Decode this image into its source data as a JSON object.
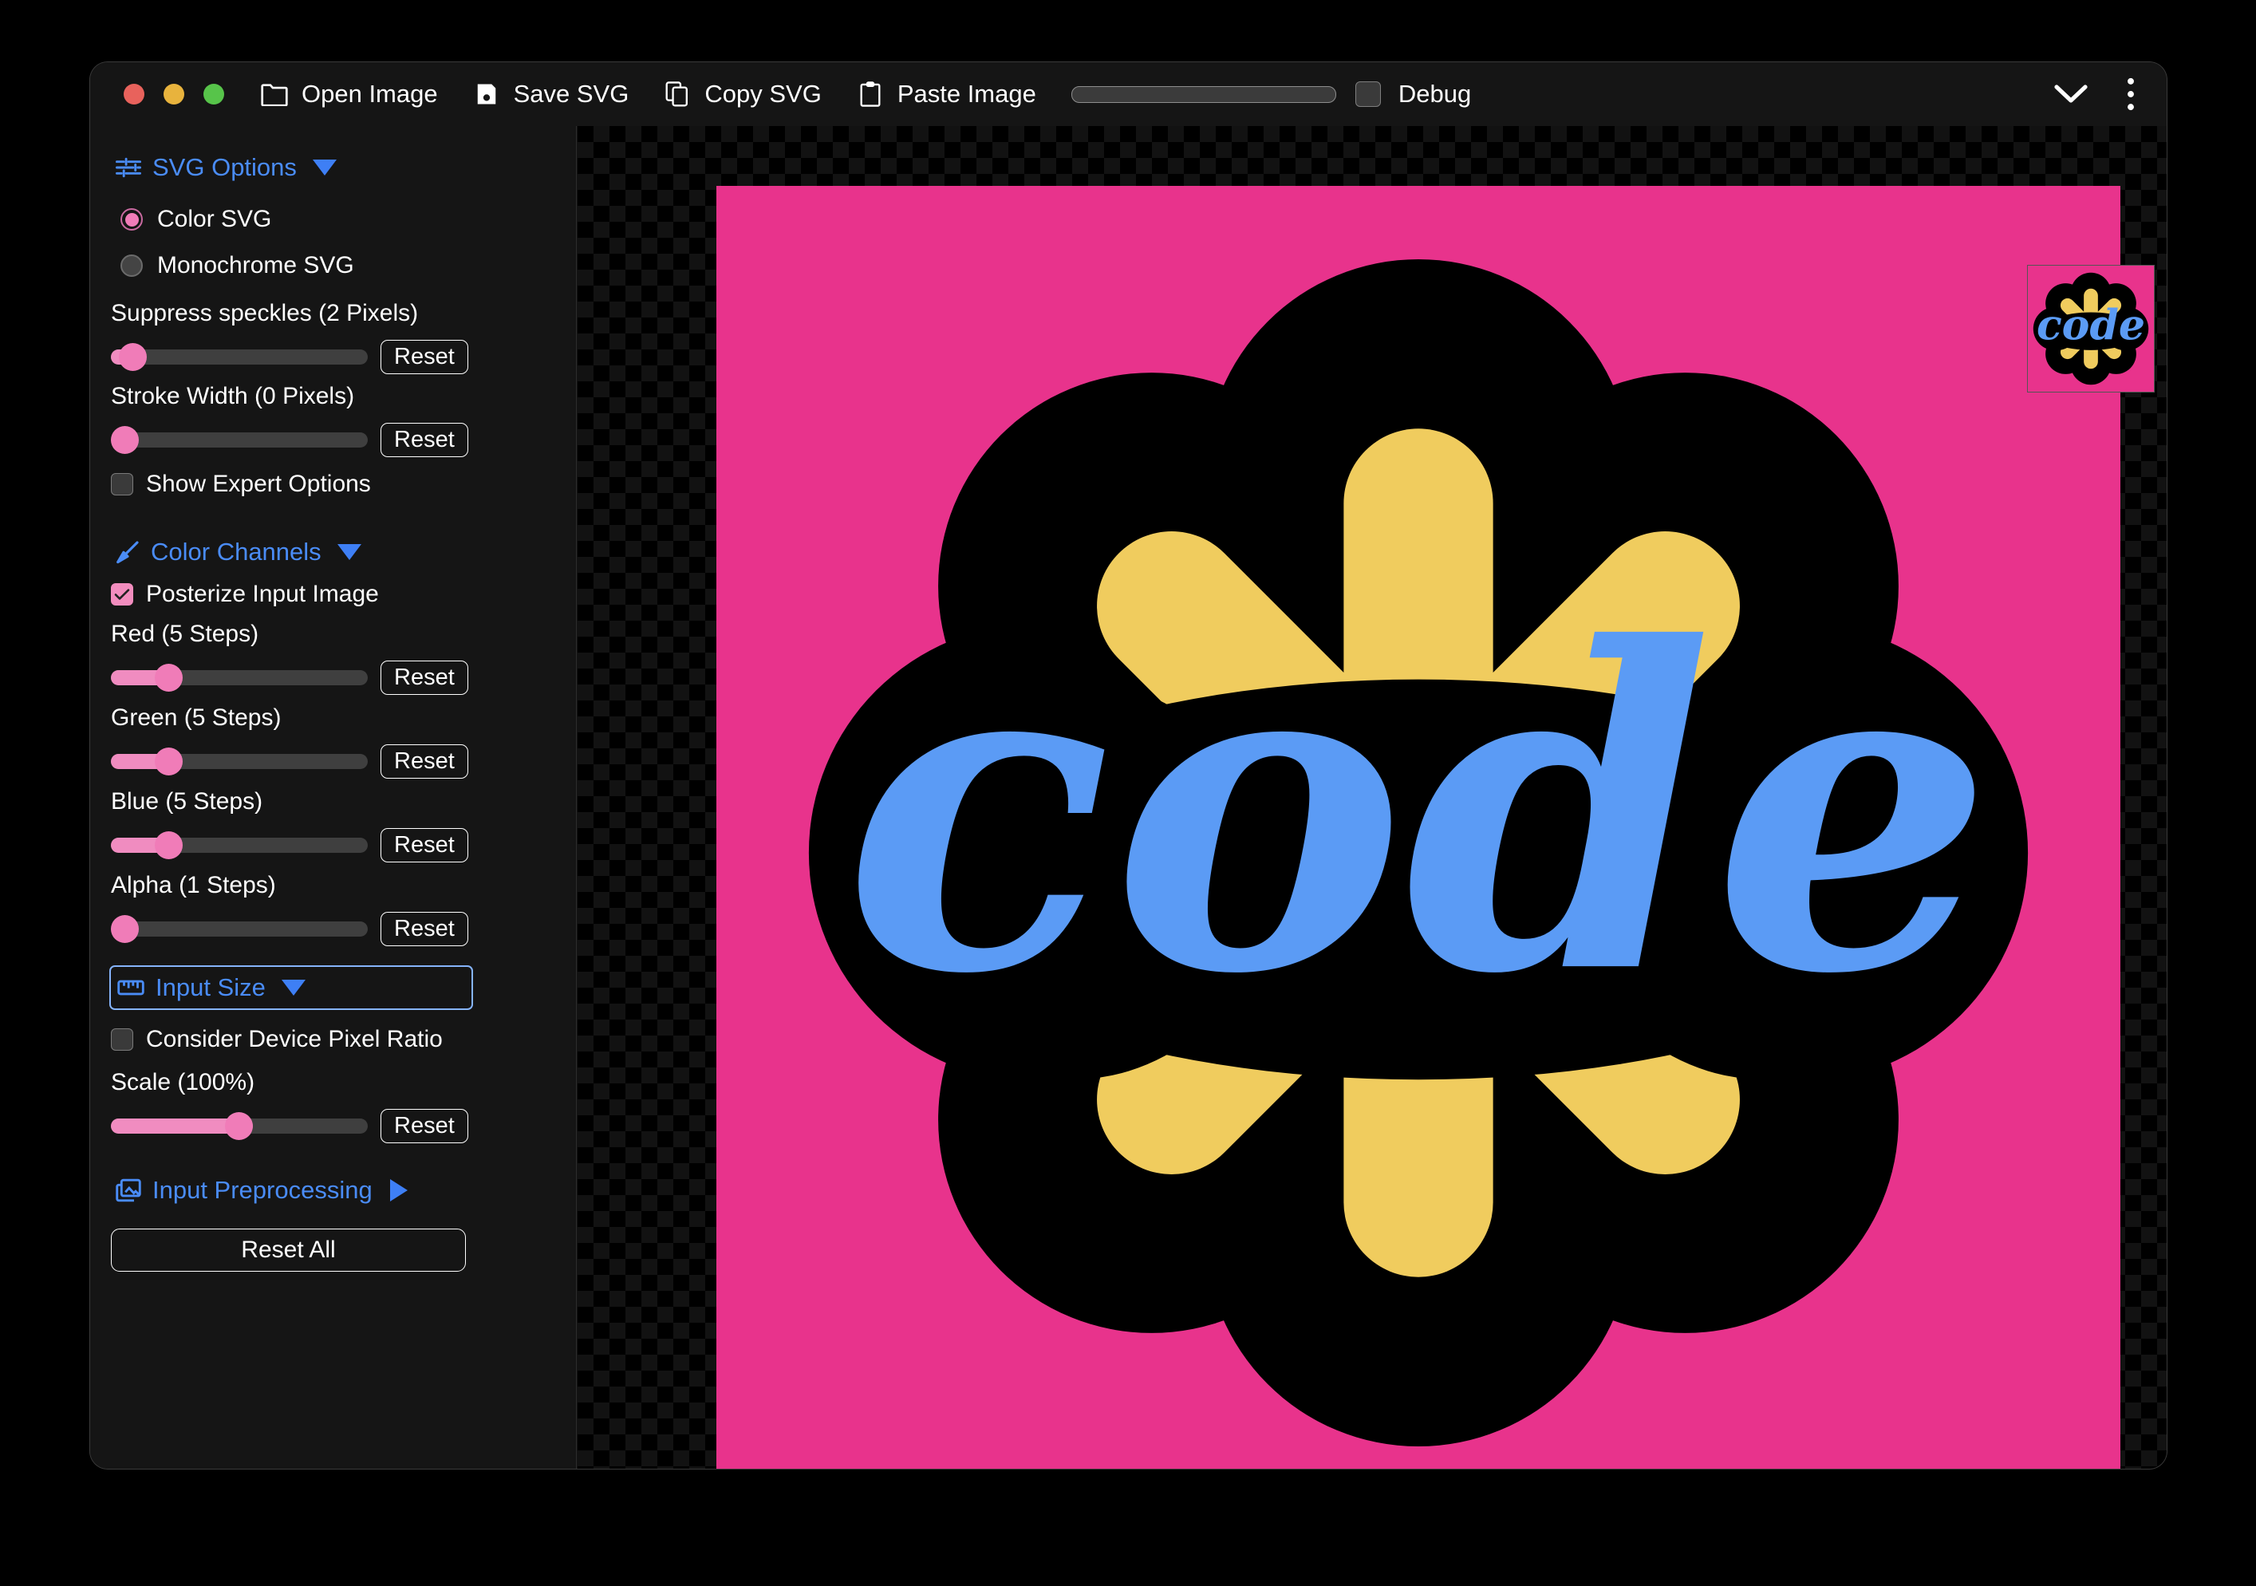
{
  "window": {
    "traffic_lights": [
      "close",
      "minimize",
      "maximize"
    ],
    "colors": {
      "close": "#e8625c",
      "minimize": "#e8b33d",
      "maximize": "#57c44a"
    }
  },
  "toolbar": {
    "buttons": [
      {
        "label": "Open Image",
        "icon": "folder-icon"
      },
      {
        "label": "Save SVG",
        "icon": "save-disk-icon"
      },
      {
        "label": "Copy SVG",
        "icon": "copy-icon"
      },
      {
        "label": "Paste Image",
        "icon": "clipboard-icon"
      }
    ],
    "progress": {
      "name": "progress-bar",
      "value": 0
    },
    "debug": {
      "label": "Debug",
      "checked": false
    },
    "right_icons": [
      {
        "name": "chevron-down-icon"
      },
      {
        "name": "more-vertical-icon"
      }
    ]
  },
  "sidebar": {
    "sections": [
      {
        "id": "svg-options",
        "title": "SVG Options",
        "icon": "sliders-icon",
        "expanded": true,
        "caret": "down",
        "focused": false
      },
      {
        "id": "color-channels",
        "title": "Color Channels",
        "icon": "brush-icon",
        "expanded": true,
        "caret": "down",
        "focused": false
      },
      {
        "id": "input-size",
        "title": "Input Size",
        "icon": "ruler-icon",
        "expanded": true,
        "caret": "down",
        "focused": true
      },
      {
        "id": "input-preprocessing",
        "title": "Input Preprocessing",
        "icon": "images-icon",
        "expanded": false,
        "caret": "right",
        "focused": false
      }
    ],
    "radios": [
      {
        "label": "Color SVG",
        "selected": true
      },
      {
        "label": "Monochrome SVG",
        "selected": false
      }
    ],
    "checkboxes": [
      {
        "id": "show-expert-options",
        "label": "Show Expert Options",
        "checked": false
      },
      {
        "id": "posterize-input-image",
        "label": "Posterize Input Image",
        "checked": true
      },
      {
        "id": "consider-device-pixel-ratio",
        "label": "Consider Device Pixel Ratio",
        "checked": false
      }
    ],
    "sliders": [
      {
        "id": "suppress-speckles",
        "label": "Suppress speckles (2 Pixels)",
        "value": 2,
        "unit": "Pixels",
        "percent": 6,
        "reset_label": "Reset"
      },
      {
        "id": "stroke-width",
        "label": "Stroke Width (0 Pixels)",
        "value": 0,
        "unit": "Pixels",
        "percent": 0,
        "reset_label": "Reset"
      },
      {
        "id": "red",
        "label": "Red (5 Steps)",
        "value": 5,
        "unit": "Steps",
        "percent": 17,
        "reset_label": "Reset"
      },
      {
        "id": "green",
        "label": "Green (5 Steps)",
        "value": 5,
        "unit": "Steps",
        "percent": 17,
        "reset_label": "Reset"
      },
      {
        "id": "blue",
        "label": "Blue (5 Steps)",
        "value": 5,
        "unit": "Steps",
        "percent": 17,
        "reset_label": "Reset"
      },
      {
        "id": "alpha",
        "label": "Alpha (1 Steps)",
        "value": 1,
        "unit": "Steps",
        "percent": 0,
        "reset_label": "Reset"
      },
      {
        "id": "scale",
        "label": "Scale (100%)",
        "value": 100,
        "unit": "%",
        "percent": 50,
        "reset_label": "Reset"
      }
    ],
    "reset_all_label": "Reset All",
    "accent_color": "#f07cb8",
    "link_color": "#4a8cf7",
    "focus_color": "#86b4fb"
  },
  "canvas": {
    "artwork": {
      "name": "code-flower-logo",
      "background": "#e8338c",
      "outline": "#000000",
      "petal_color": "#f0cc5e",
      "word": "code",
      "word_color": "#5b9bf5"
    },
    "thumbnail": {
      "name": "preview-thumbnail",
      "background": "#e8338c"
    },
    "transparency_checker": {
      "light": "#121212",
      "dark": "#000000",
      "tile": 20
    }
  }
}
